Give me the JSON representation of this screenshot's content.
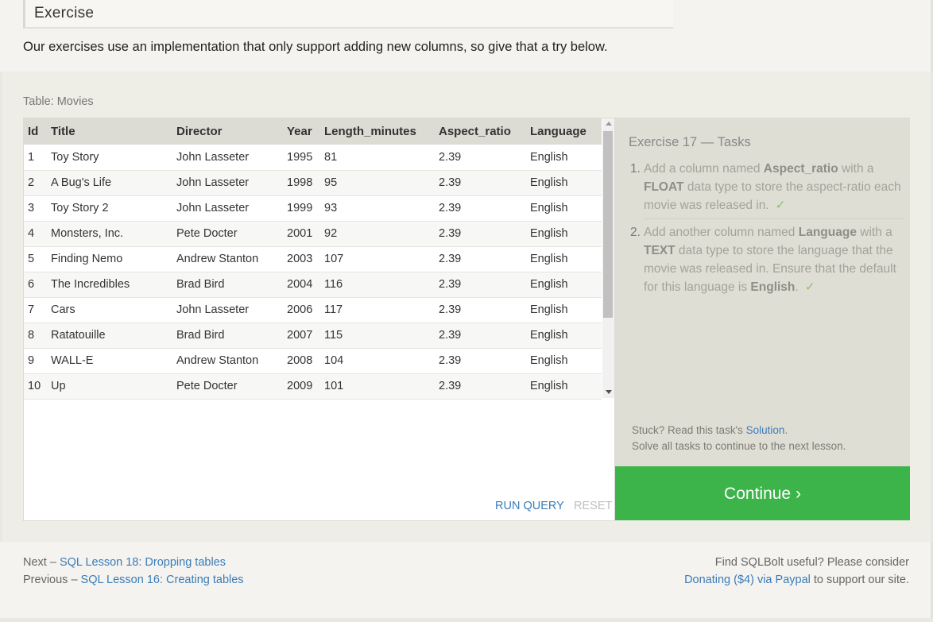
{
  "header": {
    "section_title": "Exercise",
    "intro": "Our exercises use an implementation that only support adding new columns, so give that a try below."
  },
  "table": {
    "label": "Table: Movies",
    "columns": [
      "Id",
      "Title",
      "Director",
      "Year",
      "Length_minutes",
      "Aspect_ratio",
      "Language"
    ],
    "rows": [
      [
        "1",
        "Toy Story",
        "John Lasseter",
        "1995",
        "81",
        "2.39",
        "English"
      ],
      [
        "2",
        "A Bug's Life",
        "John Lasseter",
        "1998",
        "95",
        "2.39",
        "English"
      ],
      [
        "3",
        "Toy Story 2",
        "John Lasseter",
        "1999",
        "93",
        "2.39",
        "English"
      ],
      [
        "4",
        "Monsters, Inc.",
        "Pete Docter",
        "2001",
        "92",
        "2.39",
        "English"
      ],
      [
        "5",
        "Finding Nemo",
        "Andrew Stanton",
        "2003",
        "107",
        "2.39",
        "English"
      ],
      [
        "6",
        "The Incredibles",
        "Brad Bird",
        "2004",
        "116",
        "2.39",
        "English"
      ],
      [
        "7",
        "Cars",
        "John Lasseter",
        "2006",
        "117",
        "2.39",
        "English"
      ],
      [
        "8",
        "Ratatouille",
        "Brad Bird",
        "2007",
        "115",
        "2.39",
        "English"
      ],
      [
        "9",
        "WALL-E",
        "Andrew Stanton",
        "2008",
        "104",
        "2.39",
        "English"
      ],
      [
        "10",
        "Up",
        "Pete Docter",
        "2009",
        "101",
        "2.39",
        "English"
      ]
    ]
  },
  "actions": {
    "run_query": "RUN QUERY",
    "reset": "RESET"
  },
  "tasks": {
    "title": "Exercise 17 — Tasks",
    "items": [
      {
        "num": "1.",
        "p1": "Add a column named ",
        "b1": "Aspect_ratio",
        "p2": " with a ",
        "b2": "FLOAT",
        "p3": " data type to store the aspect-ratio each movie was released in.",
        "check": "✓"
      },
      {
        "num": "2.",
        "p1": "Add another column named ",
        "b1": "Language",
        "p2": " with a ",
        "b2": "TEXT",
        "p3": " data type to store the language that the movie was released in. Ensure that the default for this language is ",
        "b3": "English",
        "p4": ".",
        "check": "✓"
      }
    ],
    "stuck_prefix": "Stuck? Read this task's ",
    "stuck_link": "Solution",
    "stuck_suffix": ".",
    "solve_all": "Solve all tasks to continue to the next lesson.",
    "continue_label": "Continue ›"
  },
  "footer": {
    "next_prefix": "Next – ",
    "next_link": "SQL Lesson 18: Dropping tables",
    "prev_prefix": "Previous – ",
    "prev_link": "SQL Lesson 16: Creating tables",
    "support_line1": "Find SQLBolt useful? Please consider",
    "support_link": "Donating ($4) via Paypal",
    "support_suffix": " to support our site."
  },
  "colors": {
    "continue_bg": "#3cb44a",
    "link": "#3b7cb8",
    "check": "#8fc46e"
  }
}
